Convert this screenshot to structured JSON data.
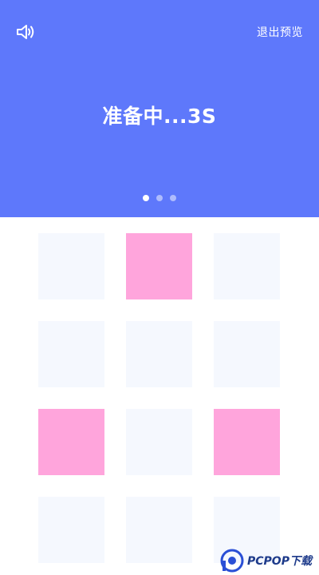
{
  "header": {
    "status_text": "准备中...3S",
    "exit_label": "退出预览",
    "sound_icon": "speaker-icon",
    "bg_color": "#5e78fb",
    "page_dots": {
      "count": 3,
      "active_index": 0
    }
  },
  "grid": {
    "rows": 4,
    "columns": 3,
    "active_color": "#ffa5dc",
    "inactive_color": "#f5f8fe",
    "cells": [
      [
        false,
        true,
        false
      ],
      [
        false,
        false,
        false
      ],
      [
        true,
        false,
        true
      ],
      [
        false,
        false,
        false
      ]
    ]
  },
  "watermark": {
    "text": "PCPOP下载"
  }
}
